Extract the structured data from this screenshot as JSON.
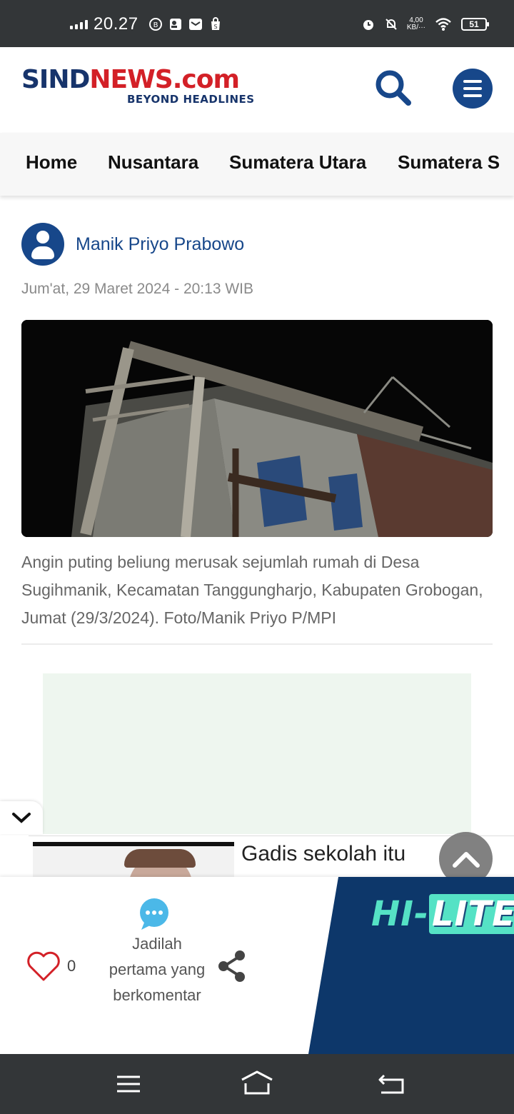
{
  "status_bar": {
    "time": "20.27",
    "net_speed_value": "4,00",
    "net_speed_unit": "KB/···",
    "battery": "51"
  },
  "header": {
    "logo_part1": "SIND",
    "logo_part2": "NEWS.com",
    "logo_tagline": "BEYOND HEADLINES"
  },
  "nav": {
    "items": [
      {
        "label": "Home"
      },
      {
        "label": "Nusantara"
      },
      {
        "label": "Sumatera Utara"
      },
      {
        "label": "Sumatera S"
      }
    ]
  },
  "article": {
    "author": "Manik Priyo Prabowo",
    "date": "Jum'at, 29 Maret 2024 - 20:13 WIB",
    "caption": "Angin puting beliung merusak sejumlah rumah di Desa Sugihmanik, Kecamatan Tanggungharjo, Kabupaten Grobogan, Jumat (29/3/2024). Foto/Manik Priyo P/MPI"
  },
  "promo": {
    "title": "Gadis sekolah itu"
  },
  "action_bar": {
    "like_count": "0",
    "comment_text": "Jadilah pertama yang berkomentar",
    "brand_part1": "HI-",
    "brand_part2": "LITE"
  },
  "colors": {
    "brand_blue": "#17346b",
    "accent_blue": "#17478a",
    "logo_red": "#d32027",
    "hilite_panel": "#0d376a",
    "hilite_green": "#55e2c5"
  },
  "icons": [
    "search-icon",
    "menu-icon",
    "avatar-icon",
    "chevron-down-icon",
    "chevron-up-icon",
    "heart-icon",
    "comment-bubble-icon",
    "share-icon",
    "recents-icon",
    "home-icon",
    "back-icon"
  ]
}
